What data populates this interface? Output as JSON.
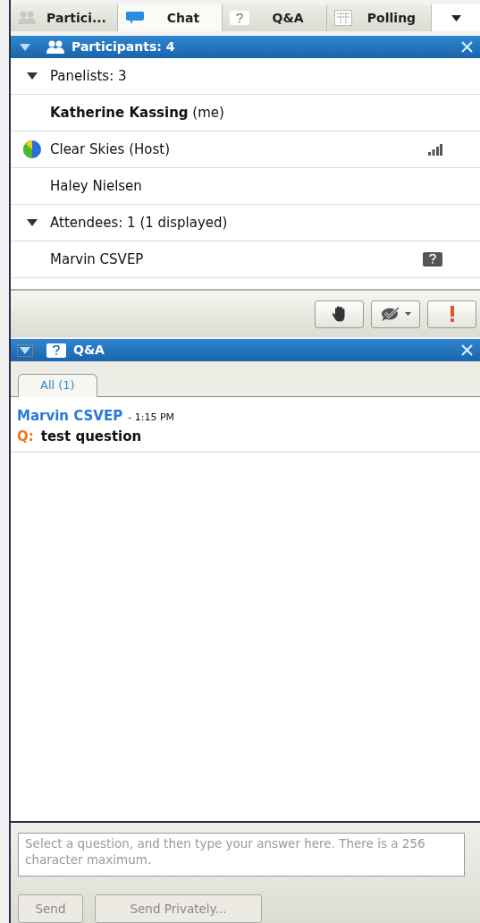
{
  "tabs": [
    {
      "label": "Partici...",
      "selected": false
    },
    {
      "label": "Chat",
      "selected": true
    },
    {
      "label": "Q&A",
      "selected": false
    },
    {
      "label": "Polling",
      "selected": false
    }
  ],
  "participants_panel": {
    "title": "Participants: 4",
    "expanded": true,
    "rows": [
      {
        "kind": "group",
        "label": "Panelists: 3",
        "expanded": true
      },
      {
        "kind": "person",
        "label": "**Katherine Kassing** (me)"
      },
      {
        "kind": "host",
        "label": "Clear Skies (Host)"
      },
      {
        "kind": "person",
        "label": "Haley Nielsen"
      },
      {
        "kind": "group",
        "label": "Attendees: 1 (1 displayed)",
        "expanded": true
      },
      {
        "kind": "attendee",
        "label": "Marvin CSVEP"
      }
    ]
  },
  "qa_panel": {
    "title": "Q&A",
    "expanded": true,
    "tabs": [
      {
        "label": "All (1)",
        "selected": true
      }
    ],
    "questions": [
      {
        "author": "Marvin CSVEP",
        "time": "- 1:15 PM",
        "prefix": "Q:",
        "text": "test question"
      }
    ],
    "answer": {
      "placeholder": "Select a question, and then type your answer here. There is a 256 character maximum."
    },
    "buttons": [
      {
        "label": "Send",
        "disabled": true
      },
      {
        "label": "Send Privately...",
        "disabled": true
      }
    ]
  }
}
